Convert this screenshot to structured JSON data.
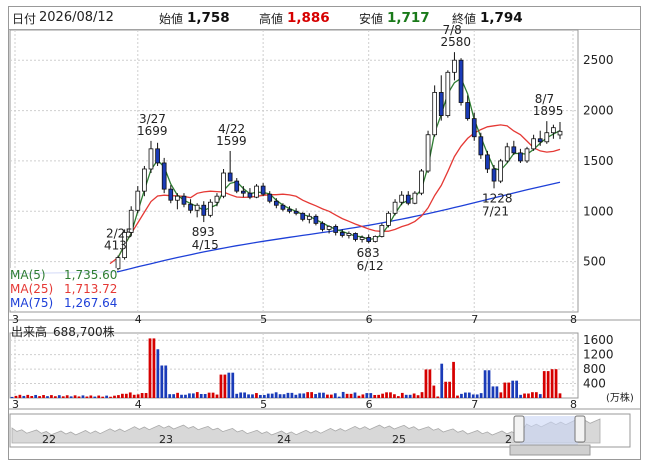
{
  "info": {
    "date_label": "日付",
    "date": "2026/08/12",
    "open_label": "始値",
    "open": "1,758",
    "high_label": "高値",
    "high": "1,886",
    "low_label": "安値",
    "low": "1,717",
    "close_label": "終値",
    "close": "1,794"
  },
  "ma": [
    {
      "label": "MA(5)",
      "value": "1,735.60",
      "color": "#2e7d32"
    },
    {
      "label": "MA(25)",
      "value": "1,713.72",
      "color": "#e53935"
    },
    {
      "label": "MA(75)",
      "value": "1,267.64",
      "color": "#1e40d8"
    }
  ],
  "volume_panel": {
    "label": "出来高",
    "value": "688,700株",
    "unit": "(万株)"
  },
  "colors": {
    "up": "#d60000",
    "down": "#1a3bb8",
    "grid": "#cfcfcf"
  },
  "chart_data": [
    {
      "type": "candlestick",
      "y_ticks": [
        "2500",
        "2000",
        "1500",
        "1000",
        "500"
      ],
      "ylim": [
        0,
        2800
      ],
      "x_ticks": [
        "3",
        "4",
        "5",
        "6",
        "7",
        "8"
      ],
      "annotations": [
        {
          "date": "2/25",
          "value": "413"
        },
        {
          "date": "3/27",
          "value": "1699"
        },
        {
          "date": "4/22",
          "value": "1599"
        },
        {
          "date": "4/15",
          "value": "893"
        },
        {
          "date": "6/12",
          "value": "683"
        },
        {
          "date": "7/8",
          "value": "2580"
        },
        {
          "date": "7/21",
          "value": "1228"
        },
        {
          "date": "8/7",
          "value": "1895"
        }
      ],
      "series": [
        {
          "name": "MA(5)"
        },
        {
          "name": "MA(25)"
        },
        {
          "name": "MA(75)"
        }
      ],
      "candles": [
        [
          430,
          560,
          413,
          540
        ],
        [
          540,
          820,
          520,
          790
        ],
        [
          790,
          1050,
          760,
          1010
        ],
        [
          1010,
          1250,
          980,
          1200
        ],
        [
          1200,
          1450,
          1150,
          1420
        ],
        [
          1420,
          1699,
          1380,
          1620
        ],
        [
          1620,
          1680,
          1450,
          1480
        ],
        [
          1480,
          1530,
          1180,
          1220
        ],
        [
          1220,
          1260,
          1080,
          1110
        ],
        [
          1110,
          1180,
          1020,
          1150
        ],
        [
          1150,
          1180,
          1040,
          1070
        ],
        [
          1070,
          1120,
          980,
          1010
        ],
        [
          1010,
          1080,
          940,
          1060
        ],
        [
          1060,
          1100,
          893,
          960
        ],
        [
          960,
          1120,
          940,
          1090
        ],
        [
          1090,
          1180,
          1050,
          1150
        ],
        [
          1150,
          1420,
          1130,
          1380
        ],
        [
          1380,
          1599,
          1340,
          1300
        ],
        [
          1300,
          1330,
          1180,
          1200
        ],
        [
          1200,
          1250,
          1140,
          1180
        ],
        [
          1180,
          1230,
          1120,
          1140
        ],
        [
          1140,
          1270,
          1130,
          1250
        ],
        [
          1250,
          1280,
          1150,
          1170
        ],
        [
          1170,
          1200,
          1080,
          1100
        ],
        [
          1100,
          1130,
          1030,
          1060
        ],
        [
          1060,
          1080,
          1000,
          1020
        ],
        [
          1020,
          1050,
          980,
          1000
        ],
        [
          1000,
          1030,
          960,
          980
        ],
        [
          980,
          990,
          900,
          920
        ],
        [
          920,
          980,
          880,
          950
        ],
        [
          950,
          970,
          860,
          880
        ],
        [
          880,
          900,
          800,
          820
        ],
        [
          820,
          860,
          780,
          850
        ],
        [
          850,
          870,
          760,
          790
        ],
        [
          790,
          820,
          740,
          760
        ],
        [
          760,
          800,
          730,
          780
        ],
        [
          780,
          790,
          700,
          720
        ],
        [
          720,
          760,
          690,
          740
        ],
        [
          740,
          770,
          683,
          700
        ],
        [
          700,
          760,
          690,
          750
        ],
        [
          750,
          880,
          740,
          860
        ],
        [
          860,
          1000,
          840,
          980
        ],
        [
          980,
          1120,
          960,
          1090
        ],
        [
          1090,
          1200,
          1060,
          1160
        ],
        [
          1160,
          1200,
          1060,
          1080
        ],
        [
          1080,
          1200,
          1070,
          1180
        ],
        [
          1180,
          1420,
          1160,
          1400
        ],
        [
          1400,
          1800,
          1380,
          1760
        ],
        [
          1760,
          2250,
          1740,
          2180
        ],
        [
          2180,
          2350,
          1900,
          1950
        ],
        [
          1950,
          2400,
          1930,
          2380
        ],
        [
          2380,
          2580,
          2300,
          2500
        ],
        [
          2500,
          2520,
          2050,
          2080
        ],
        [
          2080,
          2150,
          1900,
          1920
        ],
        [
          1920,
          1980,
          1700,
          1740
        ],
        [
          1740,
          1780,
          1520,
          1560
        ],
        [
          1560,
          1600,
          1380,
          1420
        ],
        [
          1420,
          1460,
          1228,
          1300
        ],
        [
          1300,
          1520,
          1280,
          1500
        ],
        [
          1500,
          1680,
          1480,
          1640
        ],
        [
          1640,
          1700,
          1560,
          1580
        ],
        [
          1580,
          1620,
          1480,
          1500
        ],
        [
          1500,
          1640,
          1480,
          1620
        ],
        [
          1620,
          1760,
          1600,
          1720
        ],
        [
          1720,
          1800,
          1650,
          1690
        ],
        [
          1690,
          1895,
          1670,
          1780
        ],
        [
          1780,
          1860,
          1720,
          1830
        ],
        [
          1758,
          1886,
          1717,
          1794
        ]
      ]
    },
    {
      "type": "bar",
      "name": "出来高",
      "y_ticks": [
        "1600",
        "1200",
        "800",
        "400"
      ],
      "ylim": [
        0,
        1800
      ]
    },
    {
      "type": "area",
      "name": "overview",
      "x_ticks": [
        "22",
        "23",
        "24",
        "25",
        "2"
      ]
    }
  ]
}
